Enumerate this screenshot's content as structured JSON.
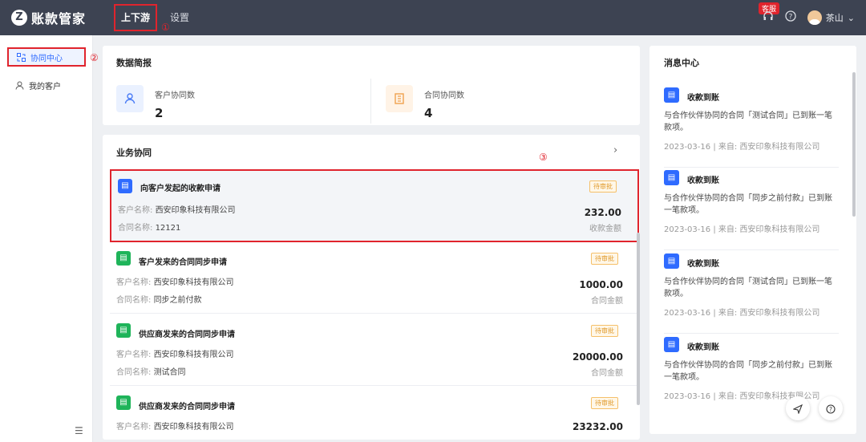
{
  "header": {
    "logo_mark": "Z",
    "app_name": "账款管家",
    "tabs": [
      {
        "label": "上下游"
      },
      {
        "label": "设置"
      }
    ],
    "kefu_badge": "客服",
    "user_name": "茶山",
    "annotation_1": "①"
  },
  "sidebar": {
    "items": [
      {
        "label": "协同中心",
        "icon": "cooperation-icon"
      },
      {
        "label": "我的客户",
        "icon": "user-icon"
      }
    ],
    "annotation_2": "②"
  },
  "summary": {
    "title": "数据简报",
    "stats": [
      {
        "label": "客户协同数",
        "value": "2",
        "icon": "customer-icon",
        "icon_color": "#4a7cf6",
        "icon_bg": "#eaf1ff"
      },
      {
        "label": "合同协同数",
        "value": "4",
        "icon": "building-icon",
        "icon_color": "#f0a24e",
        "icon_bg": "#fff3e6"
      }
    ]
  },
  "business": {
    "title": "业务协同",
    "more_icon": "chevron-right-icon",
    "annotation_3": "③",
    "customer_label": "客户名称:",
    "contract_label": "合同名称:",
    "items": [
      {
        "title": "向客户发起的收款申请",
        "icon_color": "#2f6bff",
        "badge": "待审批",
        "customer": "西安印象科技有限公司",
        "contract": "12121",
        "amount": "232.00",
        "amount_label": "收款金额"
      },
      {
        "title": "客户发来的合同同步申请",
        "icon_color": "#1fb45a",
        "badge": "待审批",
        "customer": "西安印象科技有限公司",
        "contract": "同步之前付款",
        "amount": "1000.00",
        "amount_label": "合同金额"
      },
      {
        "title": "供应商发来的合同同步申请",
        "icon_color": "#1fb45a",
        "badge": "待审批",
        "customer": "西安印象科技有限公司",
        "contract": "测试合同",
        "amount": "20000.00",
        "amount_label": "合同金额"
      },
      {
        "title": "供应商发来的合同同步申请",
        "icon_color": "#1fb45a",
        "badge": "待审批",
        "customer": "西安印象科技有限公司",
        "contract": "",
        "amount": "23232.00",
        "amount_label": ""
      }
    ]
  },
  "messages": {
    "title": "消息中心",
    "items": [
      {
        "title": "收款到账",
        "body": "与合作伙伴协同的合同「测试合同」已到账一笔款项。",
        "date": "2023-03-16",
        "sep": "|",
        "source": "来自: 西安印象科技有限公司"
      },
      {
        "title": "收款到账",
        "body": "与合作伙伴协同的合同「同步之前付款」已到账一笔款项。",
        "date": "2023-03-16",
        "sep": "|",
        "source": "来自: 西安印象科技有限公司"
      },
      {
        "title": "收款到账",
        "body": "与合作伙伴协同的合同「测试合同」已到账一笔款项。",
        "date": "2023-03-16",
        "sep": "|",
        "source": "来自: 西安印象科技有限公司"
      },
      {
        "title": "收款到账",
        "body": "与合作伙伴协同的合同「同步之前付款」已到账一笔款项。",
        "date": "2023-03-16",
        "sep": "|",
        "source": "来自: 西安印象科技有限公司"
      }
    ]
  }
}
